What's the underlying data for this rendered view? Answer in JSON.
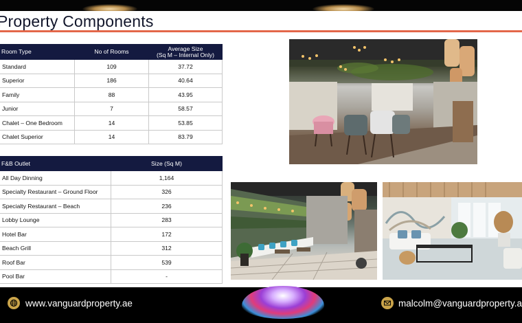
{
  "slide": {
    "title": "Property Components"
  },
  "rooms_table": {
    "headers": [
      "Room Type",
      "No of Rooms",
      "Average Size",
      "(Sq M – Internal Only)"
    ],
    "rows": [
      {
        "type": "Standard",
        "rooms": "109",
        "size": "37.72"
      },
      {
        "type": "Superior",
        "rooms": "186",
        "size": "40.64"
      },
      {
        "type": "Family",
        "rooms": "88",
        "size": "43.95"
      },
      {
        "type": "Junior",
        "rooms": "7",
        "size": "58.57"
      },
      {
        "type": "Chalet – One Bedroom",
        "rooms": "14",
        "size": "53.85"
      },
      {
        "type": "Chalet Superior",
        "rooms": "14",
        "size": "83.79"
      }
    ]
  },
  "fnb_table": {
    "headers": [
      "F&B Outlet",
      "Size (Sq M)"
    ],
    "rows": [
      {
        "outlet": "All Day Dinning",
        "size": "1,164"
      },
      {
        "outlet": "Specialty Restaurant – Ground Floor",
        "size": "326"
      },
      {
        "outlet": "Specialty Restaurant – Beach",
        "size": "236"
      },
      {
        "outlet": "Lobby Lounge",
        "size": "283"
      },
      {
        "outlet": "Hotel Bar",
        "size": "172"
      },
      {
        "outlet": "Beach Grill",
        "size": "312"
      },
      {
        "outlet": "Roof Bar",
        "size": "539"
      },
      {
        "outlet": "Pool Bar",
        "size": "-"
      }
    ]
  },
  "footer": {
    "website": "www.vanguardproperty.ae",
    "email": "malcolm@vanguardproperty.ae"
  },
  "colors": {
    "header_navy": "#141a40",
    "accent_rule": "#e3674a",
    "icon_gold": "#caa44a"
  },
  "icons": [
    "globe-icon",
    "mail-icon"
  ]
}
